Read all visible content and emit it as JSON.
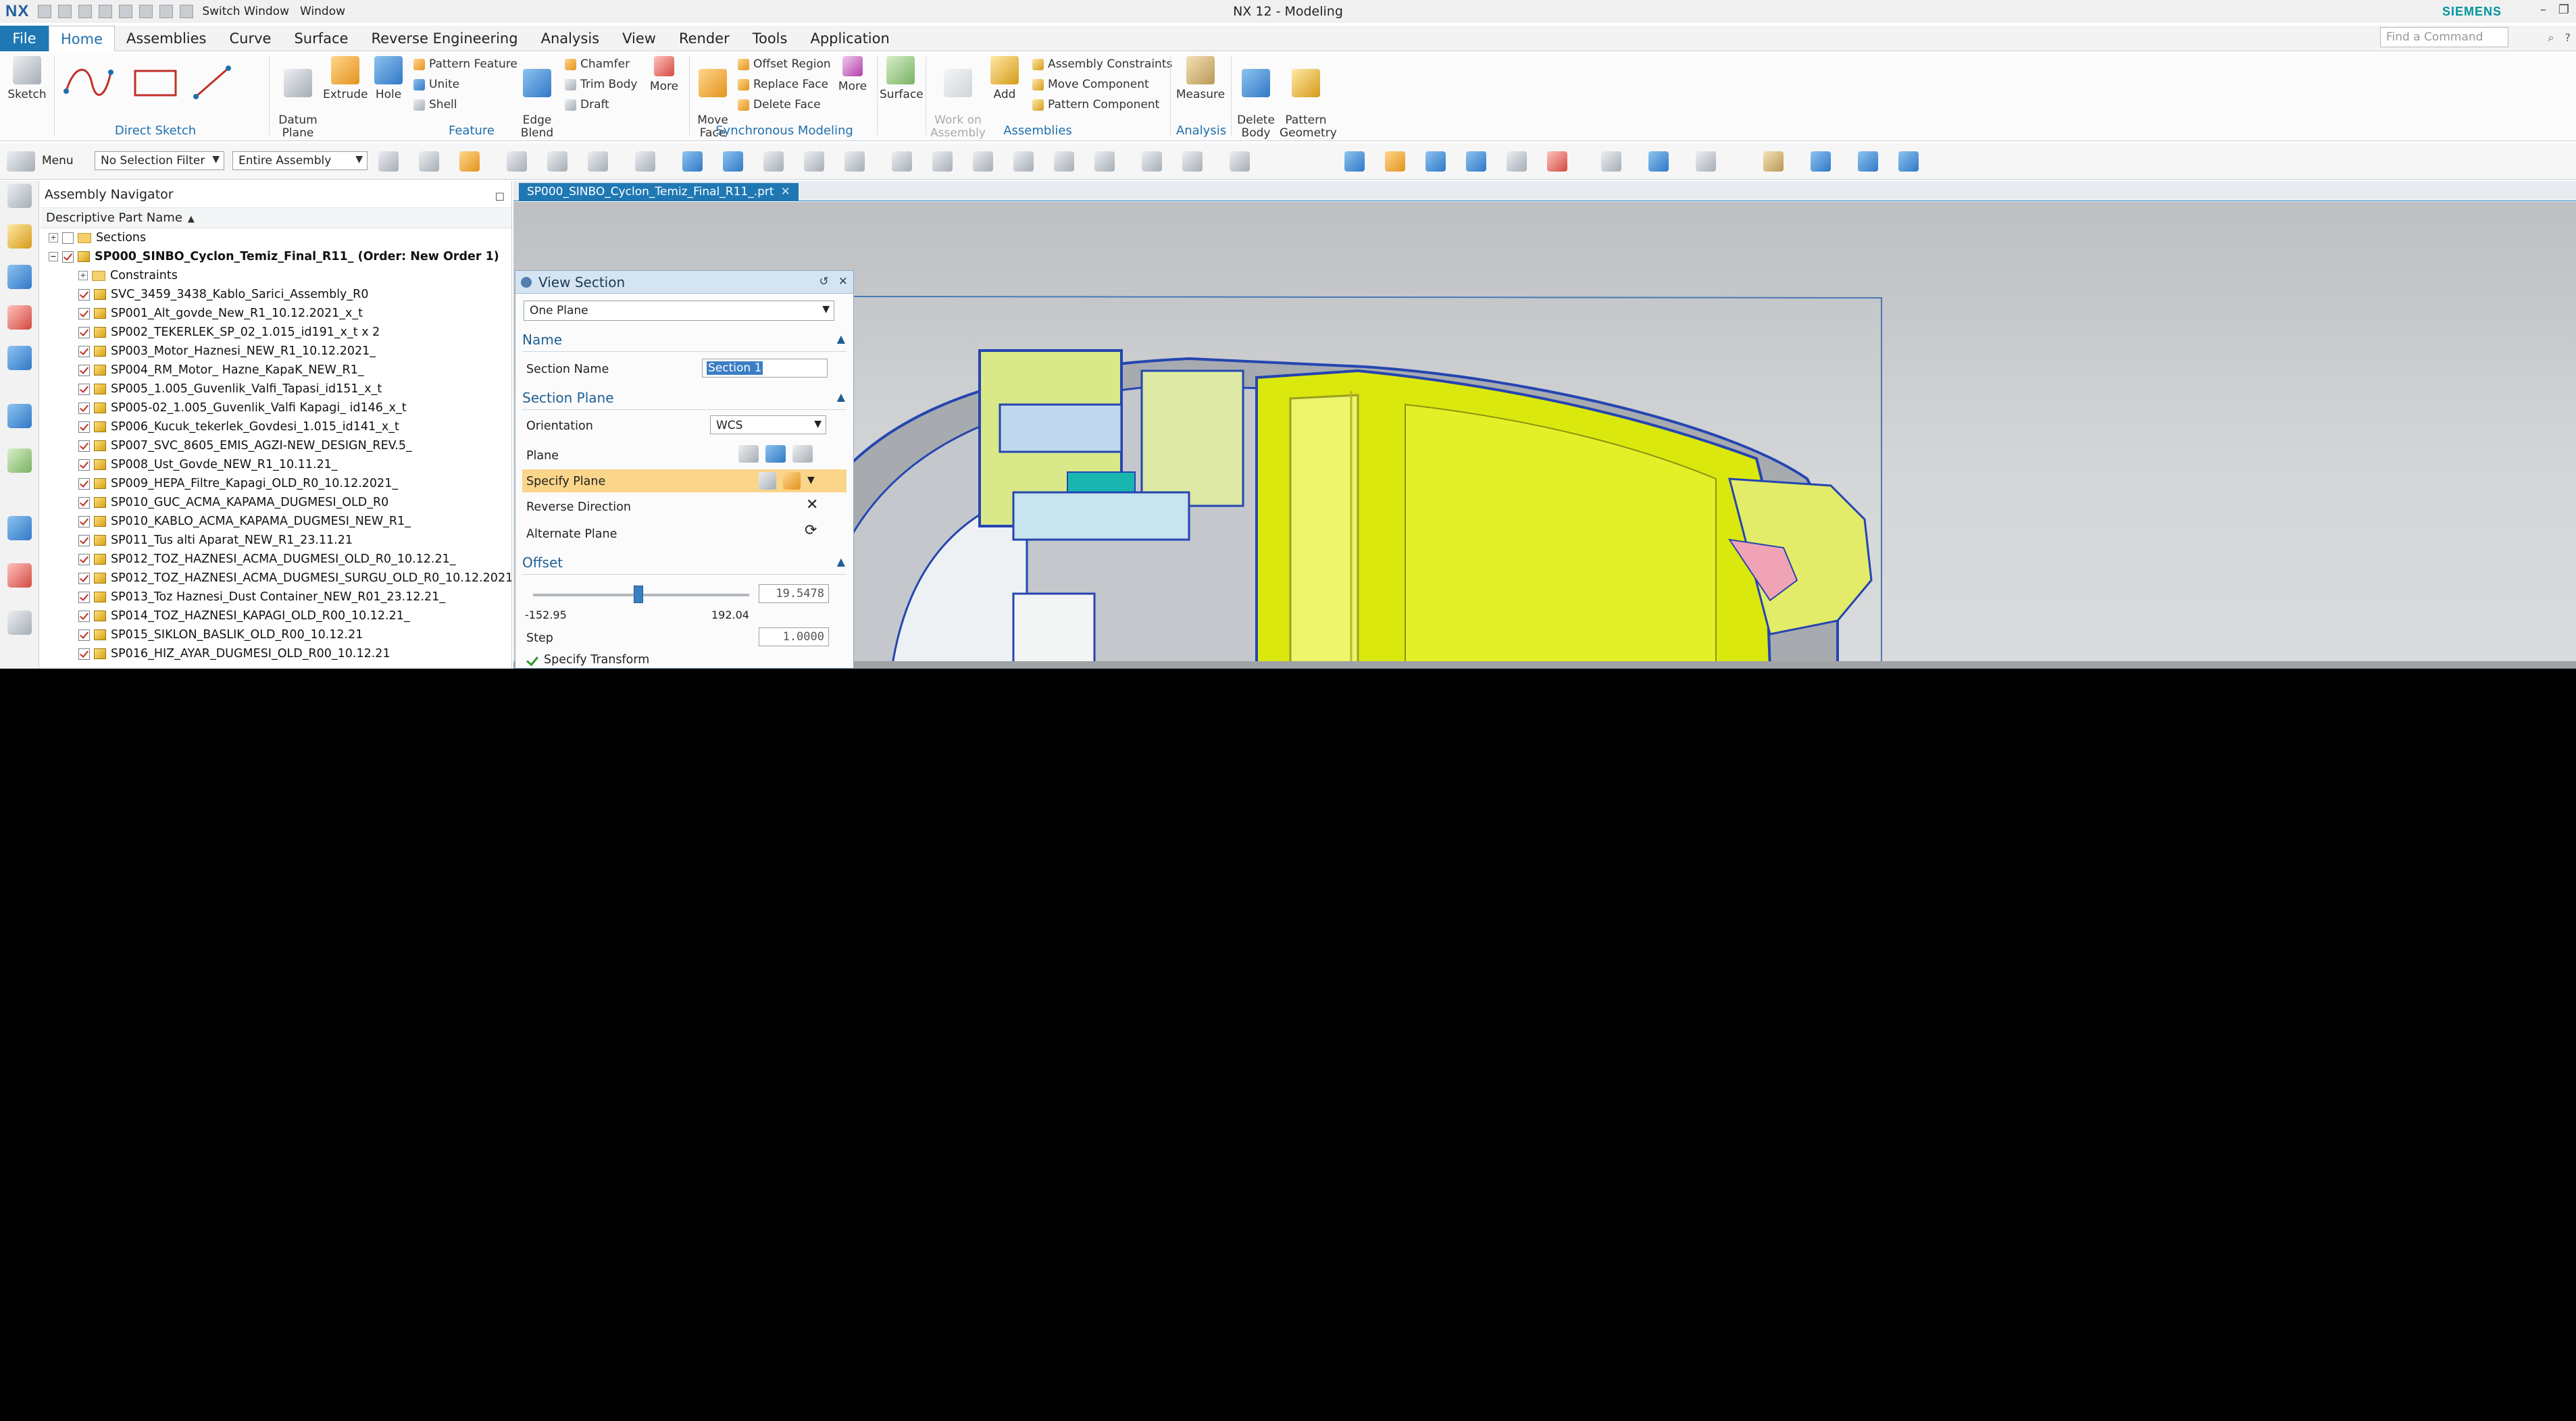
{
  "app": {
    "logo": "NX",
    "title": "NX 12 - Modeling",
    "brand": "SIEMENS",
    "quick_access": {
      "switch_window": "Switch Window",
      "window": "Window"
    },
    "find_command_placeholder": "Find a Command"
  },
  "menu_tabs": [
    "File",
    "Home",
    "Assemblies",
    "Curve",
    "Surface",
    "Reverse Engineering",
    "Analysis",
    "View",
    "Render",
    "Tools",
    "Application"
  ],
  "ribbon": {
    "sketch": "Sketch",
    "direct_sketch_group": "Direct Sketch",
    "datum_plane": "Datum\nPlane",
    "extrude": "Extrude",
    "hole": "Hole",
    "pattern_feature": "Pattern Feature",
    "unite": "Unite",
    "shell": "Shell",
    "feature_group": "Feature",
    "edge_blend": "Edge\nBlend",
    "chamfer": "Chamfer",
    "trim_body": "Trim Body",
    "draft": "Draft",
    "more1": "More",
    "move_face": "Move\nFace",
    "offset_region": "Offset Region",
    "replace_face": "Replace Face",
    "delete_face": "Delete Face",
    "more2": "More",
    "sync_group": "Synchronous Modeling",
    "surface": "Surface",
    "work_on_assembly": "Work on\nAssembly",
    "add": "Add",
    "assembly_constraints": "Assembly Constraints",
    "move_component": "Move Component",
    "pattern_component": "Pattern Component",
    "assemblies_group": "Assemblies",
    "measure": "Measure",
    "analysis_group": "Analysis",
    "delete_body": "Delete\nBody",
    "pattern_geometry": "Pattern\nGeometry"
  },
  "selection_bar": {
    "menu": "Menu",
    "filter": "No Selection Filter",
    "scope": "Entire Assembly"
  },
  "navigator": {
    "title": "Assembly Navigator",
    "column": "Descriptive Part Name",
    "rows": [
      {
        "label": "Sections",
        "kind": "folder"
      },
      {
        "label": "SP000_SINBO_Cyclon_Temiz_Final_R11_ (Order: New Order 1)",
        "kind": "root"
      },
      {
        "label": "Constraints",
        "kind": "constraints"
      },
      {
        "label": "SVC_3459_3438_Kablo_Sarici_Assembly_R0",
        "kind": "part"
      },
      {
        "label": "SP001_Alt_govde_New_R1_10.12.2021_x_t",
        "kind": "part"
      },
      {
        "label": "SP002_TEKERLEK_SP_02_1.015_id191_x_t x 2",
        "kind": "part"
      },
      {
        "label": "SP003_Motor_Haznesi_NEW_R1_10.12.2021_",
        "kind": "part"
      },
      {
        "label": "SP004_RM_Motor_ Hazne_KapaK_NEW_R1_",
        "kind": "part"
      },
      {
        "label": "SP005_1.005_Guvenlik_Valfi_Tapasi_id151_x_t",
        "kind": "part"
      },
      {
        "label": "SP005-02_1.005_Guvenlik_Valfi Kapagi_ id146_x_t",
        "kind": "part"
      },
      {
        "label": "SP006_Kucuk_tekerlek_Govdesi_1.015_id141_x_t",
        "kind": "part"
      },
      {
        "label": "SP007_SVC_8605_EMIS_AGZI-NEW_DESIGN_REV.5_",
        "kind": "part"
      },
      {
        "label": "SP008_Ust_Govde_NEW_R1_10.11.21_",
        "kind": "part"
      },
      {
        "label": "SP009_HEPA_Filtre_Kapagi_OLD_R0_10.12.2021_",
        "kind": "part"
      },
      {
        "label": "SP010_GUC_ACMA_KAPAMA_DUGMESI_OLD_R0",
        "kind": "part"
      },
      {
        "label": "SP010_KABLO_ACMA_KAPAMA_DUGMESI_NEW_R1_",
        "kind": "part"
      },
      {
        "label": "SP011_Tus alti Aparat_NEW_R1_23.11.21",
        "kind": "part"
      },
      {
        "label": "SP012_TOZ_HAZNESI_ACMA_DUGMESI_OLD_R0_10.12.21_",
        "kind": "part"
      },
      {
        "label": "SP012_TOZ_HAZNESI_ACMA_DUGMESI_SURGU_OLD_R0_10.12.2021_",
        "kind": "part"
      },
      {
        "label": "SP013_Toz Haznesi_Dust Container_NEW_R01_23.12.21_",
        "kind": "part"
      },
      {
        "label": "SP014_TOZ_HAZNESI_KAPAGI_OLD_R00_10.12.21_",
        "kind": "part"
      },
      {
        "label": "SP015_SIKLON_BASLIK_OLD_R00_10.12.21",
        "kind": "part"
      },
      {
        "label": "SP016_HIZ_AYAR_DUGMESI_OLD_R00_10.12.21",
        "kind": "part"
      }
    ]
  },
  "graphics": {
    "tab": "SP000_SINBO_Cyclon_Temiz_Final_R11_.prt"
  },
  "dialog": {
    "title": "View Section",
    "type": "One Plane",
    "name_section": "Name",
    "section_name_label": "Section Name",
    "section_name_value": "Section 1",
    "plane_section": "Section Plane",
    "orientation_label": "Orientation",
    "orientation_value": "WCS",
    "plane_label": "Plane",
    "specify_plane": "Specify Plane",
    "reverse_direction": "Reverse Direction",
    "alternate_plane": "Alternate Plane",
    "offset_section": "Offset",
    "offset_value": "19.5478",
    "offset_min": "-152.95",
    "offset_max": "192.04",
    "offset_fraction": 0.486,
    "step_label": "Step",
    "step_value": "1.0000",
    "specify_transform": "Specify Transform"
  }
}
